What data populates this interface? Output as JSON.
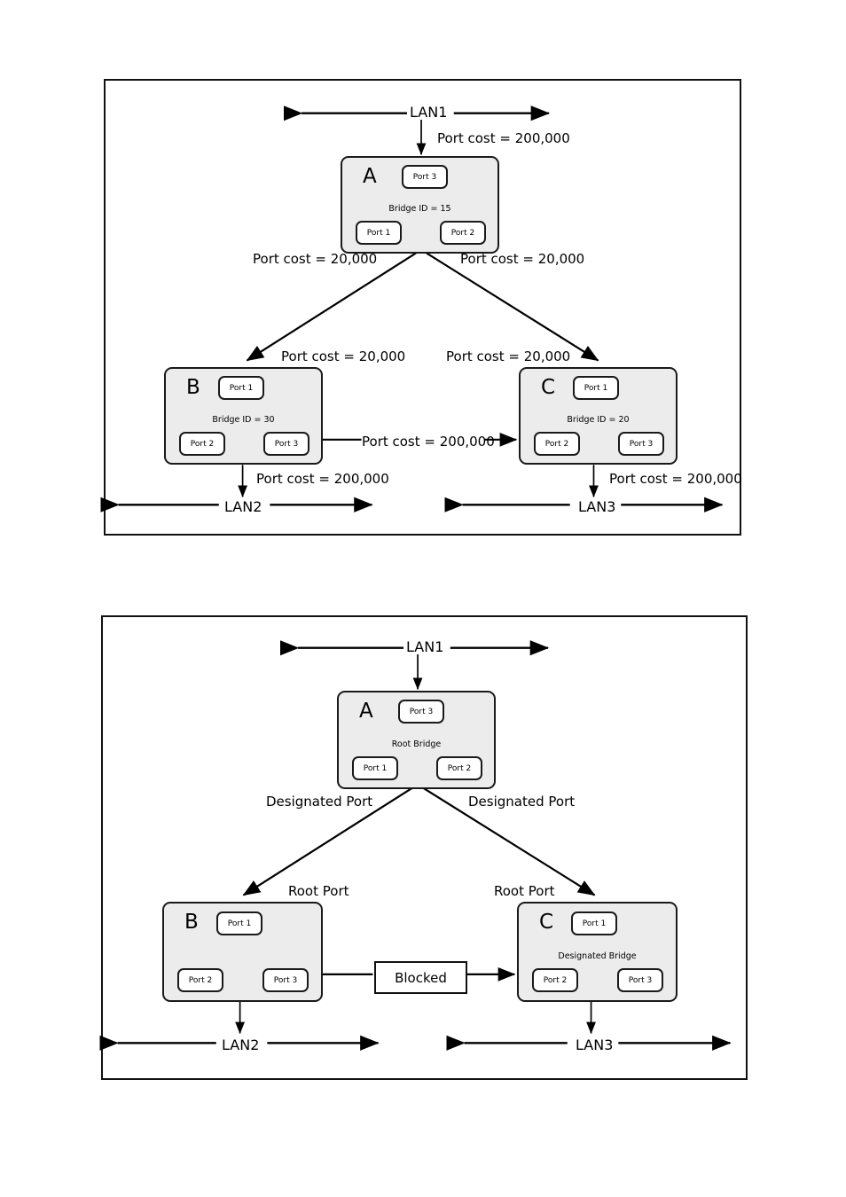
{
  "figures": [
    {
      "id": "figure-1-spanning-tree-costs",
      "caption_text": null,
      "lans": [
        {
          "name": "LAN1"
        },
        {
          "name": "LAN2"
        },
        {
          "name": "LAN3"
        }
      ],
      "bridges": [
        {
          "letter": "A",
          "subtitle": "Bridge ID = 15",
          "ports": [
            {
              "label": "Port 3"
            },
            {
              "label": "Port 1"
            },
            {
              "label": "Port 2"
            }
          ]
        },
        {
          "letter": "B",
          "subtitle": "Bridge ID = 30",
          "ports": [
            {
              "label": "Port 1"
            },
            {
              "label": "Port 2"
            },
            {
              "label": "Port 3"
            }
          ]
        },
        {
          "letter": "C",
          "subtitle": "Bridge ID = 20",
          "ports": [
            {
              "label": "Port 1"
            },
            {
              "label": "Port 2"
            },
            {
              "label": "Port 3"
            }
          ]
        }
      ],
      "cost_labels": {
        "a_to_lan1": "Port cost = 200,000",
        "a_left_upper": "Port cost = 20,000",
        "a_right_upper": "Port cost = 20,000",
        "b_upper": "Port cost = 20,000",
        "c_upper": "Port cost = 20,000",
        "b_to_c": "Port cost = 200,000",
        "b_to_lan2": "Port cost = 200,000",
        "c_to_lan3": "Port cost = 200,000"
      }
    },
    {
      "id": "figure-2-spanning-tree-roles",
      "caption_text": null,
      "lans": [
        {
          "name": "LAN1"
        },
        {
          "name": "LAN2"
        },
        {
          "name": "LAN3"
        }
      ],
      "bridges": [
        {
          "letter": "A",
          "subtitle": "Root Bridge",
          "ports": [
            {
              "label": "Port 3"
            },
            {
              "label": "Port 1"
            },
            {
              "label": "Port 2"
            }
          ]
        },
        {
          "letter": "B",
          "subtitle": "",
          "ports": [
            {
              "label": "Port 1"
            },
            {
              "label": "Port 2"
            },
            {
              "label": "Port 3"
            }
          ]
        },
        {
          "letter": "C",
          "subtitle": "Designated Bridge",
          "ports": [
            {
              "label": "Port 1"
            },
            {
              "label": "Port 2"
            },
            {
              "label": "Port 3"
            }
          ]
        }
      ],
      "role_labels": {
        "left_designated": "Designated Port",
        "right_designated": "Designated Port",
        "left_root": "Root Port",
        "right_root": "Root Port",
        "blocked": "Blocked"
      }
    }
  ],
  "colors": {
    "bridge_fill": "#ececec",
    "bridge_stroke": "#1a1a1a",
    "port_fill": "#ffffff",
    "frame_stroke": "#111111",
    "line": "#000000"
  }
}
